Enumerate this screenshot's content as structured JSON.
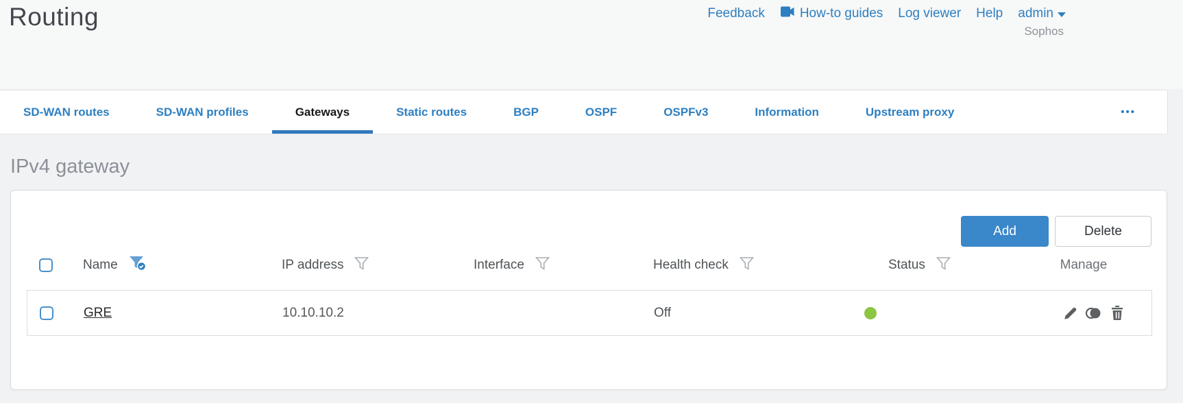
{
  "header": {
    "title": "Routing",
    "nav": {
      "feedback": "Feedback",
      "howto": "How-to guides",
      "log_viewer": "Log viewer",
      "help": "Help",
      "user": "admin",
      "brand": "Sophos"
    }
  },
  "tabs": {
    "items": [
      {
        "label": "SD-WAN routes",
        "active": false
      },
      {
        "label": "SD-WAN profiles",
        "active": false
      },
      {
        "label": "Gateways",
        "active": true
      },
      {
        "label": "Static routes",
        "active": false
      },
      {
        "label": "BGP",
        "active": false
      },
      {
        "label": "OSPF",
        "active": false
      },
      {
        "label": "OSPFv3",
        "active": false
      },
      {
        "label": "Information",
        "active": false
      },
      {
        "label": "Upstream proxy",
        "active": false
      }
    ],
    "overflow": "•••"
  },
  "section": {
    "heading": "IPv4 gateway"
  },
  "toolbar": {
    "add_label": "Add",
    "delete_label": "Delete"
  },
  "table": {
    "columns": [
      {
        "label": "Name",
        "filter": "active"
      },
      {
        "label": "IP address",
        "filter": "default"
      },
      {
        "label": "Interface",
        "filter": "default"
      },
      {
        "label": "Health check",
        "filter": "default"
      },
      {
        "label": "Status",
        "filter": "default"
      },
      {
        "label": "Manage",
        "filter": "none"
      }
    ],
    "rows": [
      {
        "name": "GRE",
        "ip_address": "10.10.10.2",
        "interface": "",
        "health_check": "Off",
        "status": "up",
        "manage": [
          "edit",
          "clone",
          "delete"
        ]
      }
    ]
  },
  "colors": {
    "accent_blue": "#2d7fc1",
    "active_tab_underline": "#3279bd",
    "add_button_bg": "#3a87c9",
    "status_up_green": "#8bc541"
  }
}
